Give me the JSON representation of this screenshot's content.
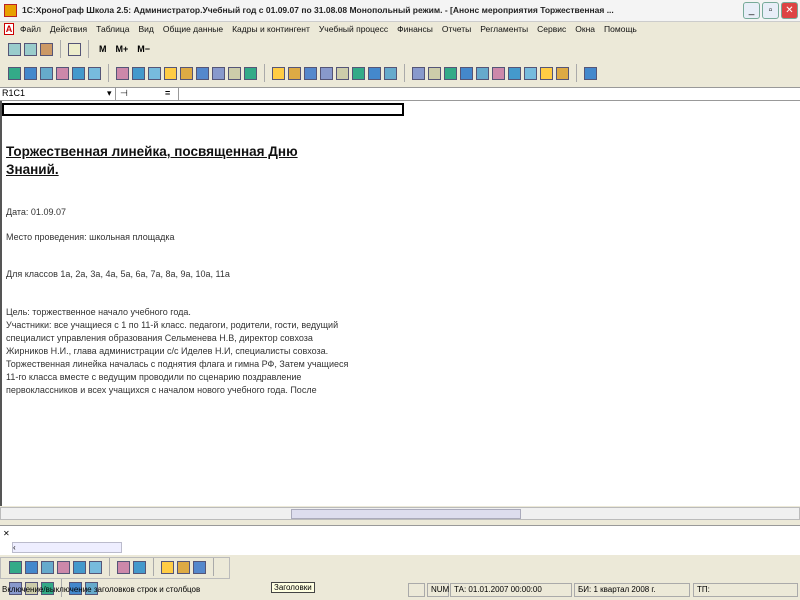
{
  "window": {
    "title": "1С:ХроноГраф Школа 2.5: Администратор.Учебный год с 01.09.07 по 31.08.08 Монопольный режим. - [Анонс мероприятия Торжественная ...",
    "min": "_",
    "max": "▫",
    "close": "✕"
  },
  "menu": [
    "Файл",
    "Действия",
    "Таблица",
    "Вид",
    "Общие данные",
    "Кадры и контингент",
    "Учебный процесс",
    "Финансы",
    "Отчеты",
    "Регламенты",
    "Сервис",
    "Окна",
    "Помощь"
  ],
  "toolbar1": {
    "m": "M",
    "mplus": "M+",
    "mminus": "M−"
  },
  "formula": {
    "cell_ref": "R1C1",
    "equals": "="
  },
  "document": {
    "heading": "Торжественная линейка, посвященная Дню Знаний.",
    "date": "Дата: 01.09.07",
    "place": "Место проведения: школьная площадка",
    "classes": "Для классов 1а, 2а, 3а, 4а, 5а, 6а, 7а, 8а, 9а, 10а, 11а",
    "lines": [
      "Цель: торжественное начало учебного года.",
      "Участники: все учащиеся  с 1 по 11-й класс. педагоги, родители, гости,  ведущий",
      "специалист управления образования Сельменева Н.В, директор совхоза",
      "Жирников Н.И., глава администрации с/с Иделев Н.И, специалисты совхоза.",
      "Торжественная линейка началась с поднятия флага и гимна РФ, Затем учащиеся",
      "11-го класса вместе с ведущим проводили по сценарию поздравление",
      "первоклассников и всех учащихся с началом нового учебного года. После"
    ]
  },
  "tooltip": "Заголовки",
  "status": {
    "hint": "Включение/выключение заголовков строк и столбцов",
    "num": "NUM",
    "ta": "ТА: 01.01.2007  00:00:00",
    "bi": "БИ: 1 квартал 2008 г.",
    "tp": "ТП:"
  }
}
